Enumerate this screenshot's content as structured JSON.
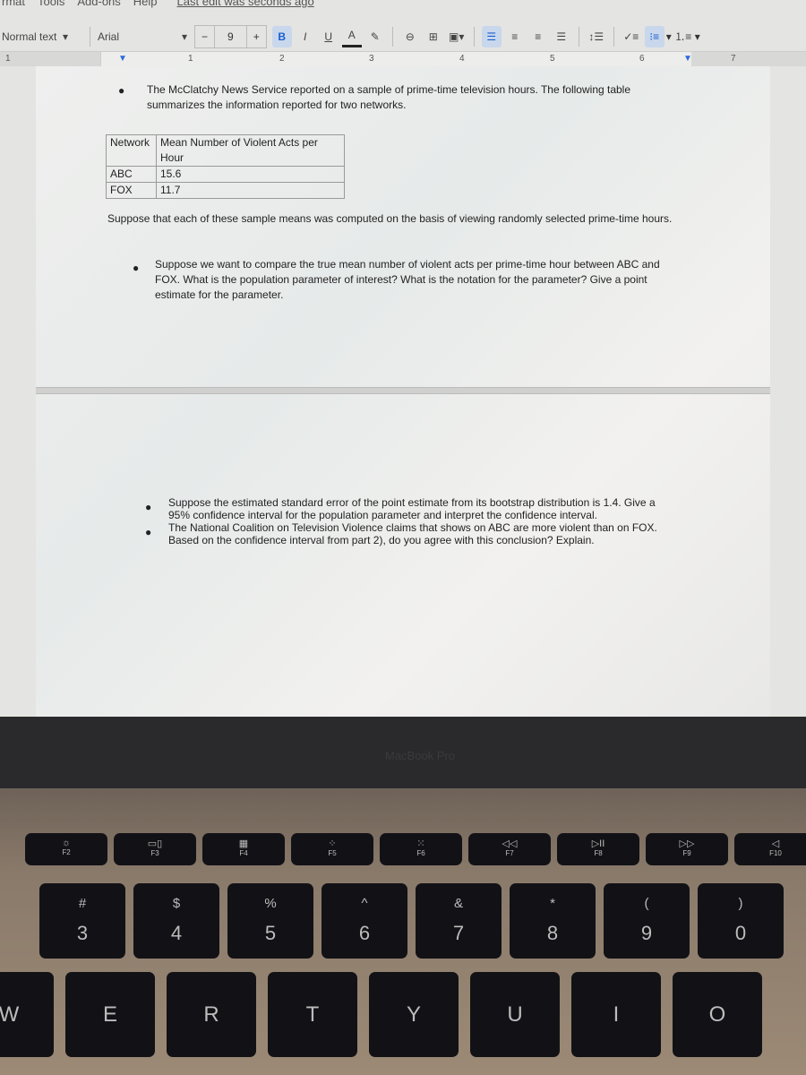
{
  "menu": [
    "rmat",
    "Tools",
    "Add-ons",
    "Help"
  ],
  "last_edit": "Last edit was seconds ago",
  "toolbar": {
    "style": "Normal text",
    "font": "Arial",
    "font_size": "9",
    "minus": "−",
    "plus": "+",
    "bold": "B",
    "italic": "I",
    "underline": "U",
    "text_color": "A"
  },
  "ruler": [
    "1",
    "1",
    "2",
    "3",
    "4",
    "5",
    "6",
    "7"
  ],
  "doc": {
    "bullet1": "The McClatchy News Service reported on a sample of prime-time television hours. The following table summarizes the information reported for two networks.",
    "table": {
      "headers": [
        "Network",
        "Mean Number of Violent Acts per Hour"
      ],
      "rows": [
        [
          "ABC",
          "15.6"
        ],
        [
          "FOX",
          "11.7"
        ]
      ]
    },
    "para": "Suppose that each of these sample means was computed on the basis of viewing  randomly selected prime-time hours.",
    "bullet2": "Suppose we want to compare the true mean number of violent acts per prime-time hour between ABC and FOX. What is the population parameter of interest? What is the notation for the parameter? Give a point estimate for the parameter.",
    "bullet3": "Suppose the estimated standard error of the point estimate from its bootstrap distribution is 1.4. Give a 95% confidence interval for the population parameter and interpret the confidence interval.",
    "bullet4": "The National Coalition on Television Violence claims that shows on ABC are more violent than on FOX. Based on the confidence interval from part 2), do you agree with this conclusion? Explain."
  },
  "bezel_text": "MacBook Pro",
  "keyboard": {
    "fkeys": [
      {
        "g": "☼",
        "l": "F2"
      },
      {
        "g": "▭▯",
        "l": "F3"
      },
      {
        "g": "▦",
        "l": "F4"
      },
      {
        "g": "⁘",
        "l": "F5"
      },
      {
        "g": "⁙",
        "l": "F6"
      },
      {
        "g": "◁◁",
        "l": "F7"
      },
      {
        "g": "▷II",
        "l": "F8"
      },
      {
        "g": "▷▷",
        "l": "F9"
      },
      {
        "g": "◁",
        "l": "F10"
      }
    ],
    "numkeys": [
      {
        "s": "#",
        "m": "3"
      },
      {
        "s": "$",
        "m": "4"
      },
      {
        "s": "%",
        "m": "5"
      },
      {
        "s": "^",
        "m": "6"
      },
      {
        "s": "&",
        "m": "7"
      },
      {
        "s": "*",
        "m": "8"
      },
      {
        "s": "(",
        "m": "9"
      },
      {
        "s": ")",
        "m": "0"
      }
    ],
    "letters": [
      "W",
      "E",
      "R",
      "T",
      "Y",
      "U",
      "I",
      "O"
    ]
  }
}
